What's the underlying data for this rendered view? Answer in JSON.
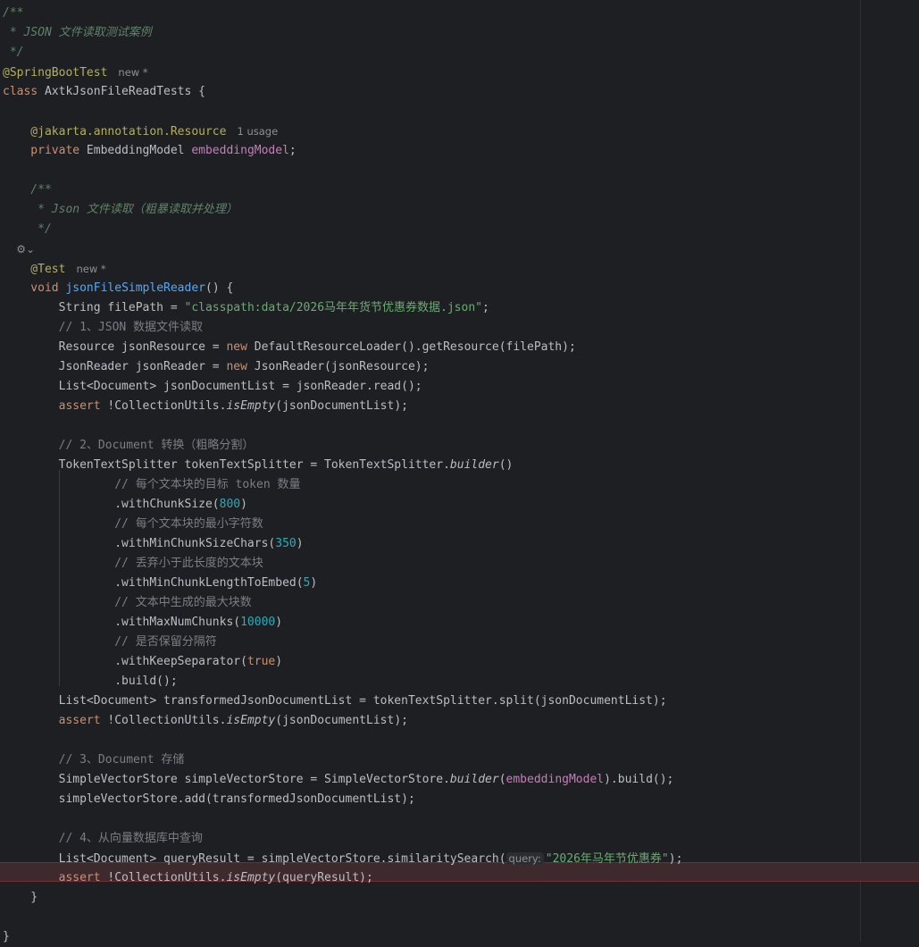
{
  "editor": {
    "highlighted_line": 44,
    "lines": [
      [
        {
          "text": "/**",
          "type": "doc"
        }
      ],
      [
        {
          "text": " * JSON 文件读取测试案例",
          "type": "doc"
        }
      ],
      [
        {
          "text": " */",
          "type": "doc"
        }
      ],
      [
        {
          "text": "@SpringBootTest",
          "type": "annotation"
        },
        {
          "text": "new *",
          "type": "hint"
        }
      ],
      [
        {
          "text": "class ",
          "type": "keyword"
        },
        {
          "text": "AxtkJsonFileReadTests {",
          "type": "default"
        }
      ],
      [],
      [
        {
          "text": "    @jakarta.annotation.",
          "type": "annotation"
        },
        {
          "text": "Resource",
          "type": "annotation"
        },
        {
          "text": "1 usage",
          "type": "hint"
        }
      ],
      [
        {
          "text": "    private ",
          "type": "keyword"
        },
        {
          "text": "EmbeddingModel ",
          "type": "default"
        },
        {
          "text": "embeddingModel",
          "type": "field"
        },
        {
          "text": ";",
          "type": "default"
        }
      ],
      [],
      [
        {
          "text": "    /**",
          "type": "doc"
        }
      ],
      [
        {
          "text": "     * Json 文件读取（粗暴读取并处理）",
          "type": "doc"
        }
      ],
      [
        {
          "text": "     */",
          "type": "doc"
        }
      ],
      [
        {
          "text": "    ⚙⌄",
          "type": "gutter-icon"
        }
      ],
      [
        {
          "text": "    @Test",
          "type": "annotation"
        },
        {
          "text": "new *",
          "type": "hint"
        }
      ],
      [
        {
          "text": "    void ",
          "type": "keyword"
        },
        {
          "text": "jsonFileSimpleReader",
          "type": "method"
        },
        {
          "text": "() {",
          "type": "default"
        }
      ],
      [
        {
          "text": "        String filePath = ",
          "type": "default"
        },
        {
          "text": "\"classpath:data/2026马年年货节优惠券数据.json\"",
          "type": "string"
        },
        {
          "text": ";",
          "type": "default"
        }
      ],
      [
        {
          "text": "        // 1、JSON 数据文件读取",
          "type": "comment"
        }
      ],
      [
        {
          "text": "        Resource jsonResource = ",
          "type": "default"
        },
        {
          "text": "new ",
          "type": "keyword"
        },
        {
          "text": "DefaultResourceLoader().getResource(filePath);",
          "type": "default"
        }
      ],
      [
        {
          "text": "        JsonReader jsonReader = ",
          "type": "default"
        },
        {
          "text": "new ",
          "type": "keyword"
        },
        {
          "text": "JsonReader(jsonResource);",
          "type": "default"
        }
      ],
      [
        {
          "text": "        List<Document> jsonDocumentList = jsonReader.read();",
          "type": "default"
        }
      ],
      [
        {
          "text": "        assert ",
          "type": "keyword"
        },
        {
          "text": "!CollectionUtils.",
          "type": "default"
        },
        {
          "text": "isEmpty",
          "type": "italic"
        },
        {
          "text": "(jsonDocumentList);",
          "type": "default"
        }
      ],
      [],
      [
        {
          "text": "        // 2、Document 转换（粗略分割）",
          "type": "comment"
        }
      ],
      [
        {
          "text": "        TokenTextSplitter tokenTextSplitter = TokenTextSplitter.",
          "type": "default"
        },
        {
          "text": "builder",
          "type": "italic"
        },
        {
          "text": "()",
          "type": "default"
        }
      ],
      [
        {
          "text": "                // 每个文本块的目标 token 数量",
          "type": "comment"
        }
      ],
      [
        {
          "text": "                .withChunkSize(",
          "type": "default"
        },
        {
          "text": "800",
          "type": "number"
        },
        {
          "text": ")",
          "type": "default"
        }
      ],
      [
        {
          "text": "                // 每个文本块的最小字符数",
          "type": "comment"
        }
      ],
      [
        {
          "text": "                .withMinChunkSizeChars(",
          "type": "default"
        },
        {
          "text": "350",
          "type": "number"
        },
        {
          "text": ")",
          "type": "default"
        }
      ],
      [
        {
          "text": "                // 丢弃小于此长度的文本块",
          "type": "comment"
        }
      ],
      [
        {
          "text": "                .withMinChunkLengthToEmbed(",
          "type": "default"
        },
        {
          "text": "5",
          "type": "number"
        },
        {
          "text": ")",
          "type": "default"
        }
      ],
      [
        {
          "text": "                // 文本中生成的最大块数",
          "type": "comment"
        }
      ],
      [
        {
          "text": "                .withMaxNumChunks(",
          "type": "default"
        },
        {
          "text": "10000",
          "type": "number"
        },
        {
          "text": ")",
          "type": "default"
        }
      ],
      [
        {
          "text": "                // 是否保留分隔符",
          "type": "comment"
        }
      ],
      [
        {
          "text": "                .withKeepSeparator(",
          "type": "default"
        },
        {
          "text": "true",
          "type": "keyword"
        },
        {
          "text": ")",
          "type": "default"
        }
      ],
      [
        {
          "text": "                .build();",
          "type": "default"
        }
      ],
      [
        {
          "text": "        List<Document> transformedJsonDocumentList = tokenTextSplitter.split(jsonDocumentList);",
          "type": "default"
        }
      ],
      [
        {
          "text": "        assert ",
          "type": "keyword"
        },
        {
          "text": "!CollectionUtils.",
          "type": "default"
        },
        {
          "text": "isEmpty",
          "type": "italic"
        },
        {
          "text": "(jsonDocumentList);",
          "type": "default"
        }
      ],
      [],
      [
        {
          "text": "        // 3、Document 存储",
          "type": "comment"
        }
      ],
      [
        {
          "text": "        SimpleVectorStore simpleVectorStore = SimpleVectorStore.",
          "type": "default"
        },
        {
          "text": "builder",
          "type": "italic"
        },
        {
          "text": "(",
          "type": "default"
        },
        {
          "text": "embeddingModel",
          "type": "field"
        },
        {
          "text": ").build();",
          "type": "default"
        }
      ],
      [
        {
          "text": "        simpleVectorStore.add(transformedJsonDocumentList);",
          "type": "default"
        }
      ],
      [],
      [
        {
          "text": "        // 4、从向量数据库中查询",
          "type": "comment"
        }
      ],
      [
        {
          "text": "        List<Document> queryResult = simpleVectorStore.similaritySearch(",
          "type": "default"
        },
        {
          "text": "query:",
          "type": "param-hint"
        },
        {
          "text": "\"2026年马年节优惠券\"",
          "type": "string"
        },
        {
          "text": ");",
          "type": "default"
        }
      ],
      [
        {
          "text": "        assert ",
          "type": "keyword"
        },
        {
          "text": "!CollectionUtils.",
          "type": "default"
        },
        {
          "text": "isEmpty",
          "type": "italic"
        },
        {
          "text": "(queryResult);",
          "type": "default"
        }
      ],
      [
        {
          "text": "    }",
          "type": "default"
        }
      ],
      [],
      [
        {
          "text": "}",
          "type": "default"
        }
      ]
    ]
  }
}
